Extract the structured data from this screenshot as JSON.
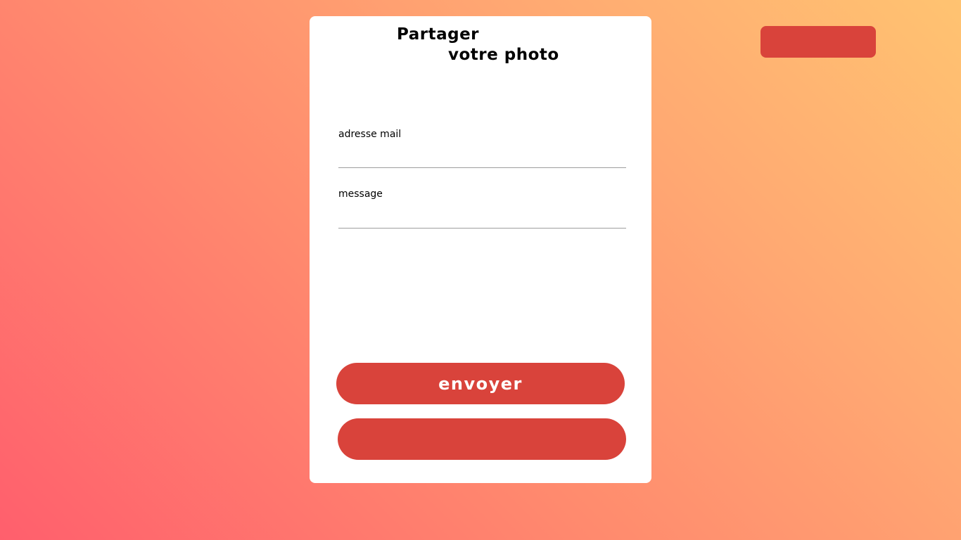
{
  "colors": {
    "accent": "#d9433b",
    "card_background": "#ffffff",
    "gradient_start": "#ff5f6d",
    "gradient_end": "#ffc371"
  },
  "header": {
    "top_button_label": ""
  },
  "card": {
    "title_line_1": "Partager",
    "title_line_2": "votre photo",
    "email_label": "adresse mail",
    "email_value": "",
    "message_label": "message",
    "message_value": "",
    "send_button_label": "envoyer",
    "second_button_label": ""
  }
}
